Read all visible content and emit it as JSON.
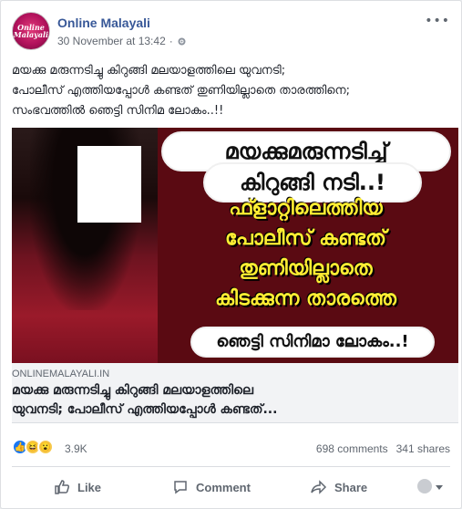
{
  "post": {
    "page_name": "Online Malayali",
    "avatar_text": "Online Malayali",
    "timestamp": "30 November at 13:42",
    "separator": "·",
    "text_lines": [
      "മയക്കു മരുന്നടിച്ചു കിറുങ്ങി മലയാളത്തിലെ യുവനടി;",
      "പോലീസ് എത്തിയപ്പോൾ കണ്ടത് തുണിയില്ലാതെ താരത്തിനെ;",
      "സംഭവത്തിൽ ഞെട്ടി സിനിമ ലോകം..!!"
    ]
  },
  "image": {
    "headline_1": "മയക്കുമരുന്നടിച്ച്",
    "headline_2": "കിറുങ്ങി നടി..!",
    "yellow_lines": [
      "ഫ്ളാറ്റിലെത്തിയ",
      "പോലീസ് കണ്ടത്",
      "തുണിയില്ലാതെ",
      "കിടക്കുന്ന താരത്തെ"
    ],
    "footer": "ഞെട്ടി സിനിമാ ലോകം..!"
  },
  "link": {
    "domain": "ONLINEMALAYALI.IN",
    "title_lines": [
      "മയക്കു മരുന്നടിച്ചു കിറുങ്ങി മലയാളത്തിലെ",
      "യുവനടി; പോലീസ് എത്തിയപ്പോൾ കണ്ടത്..."
    ]
  },
  "reactions": {
    "count": "3.9K",
    "comments": "698 comments",
    "shares": "341 shares",
    "icons": [
      "like-icon",
      "haha-icon",
      "wow-icon"
    ]
  },
  "actions": {
    "like": "Like",
    "comment": "Comment",
    "share": "Share"
  },
  "colors": {
    "link_blue": "#385898",
    "like_blue": "#1877f2",
    "banner_yellow": "#ffee33",
    "banner_bg": "#5a0a12"
  }
}
